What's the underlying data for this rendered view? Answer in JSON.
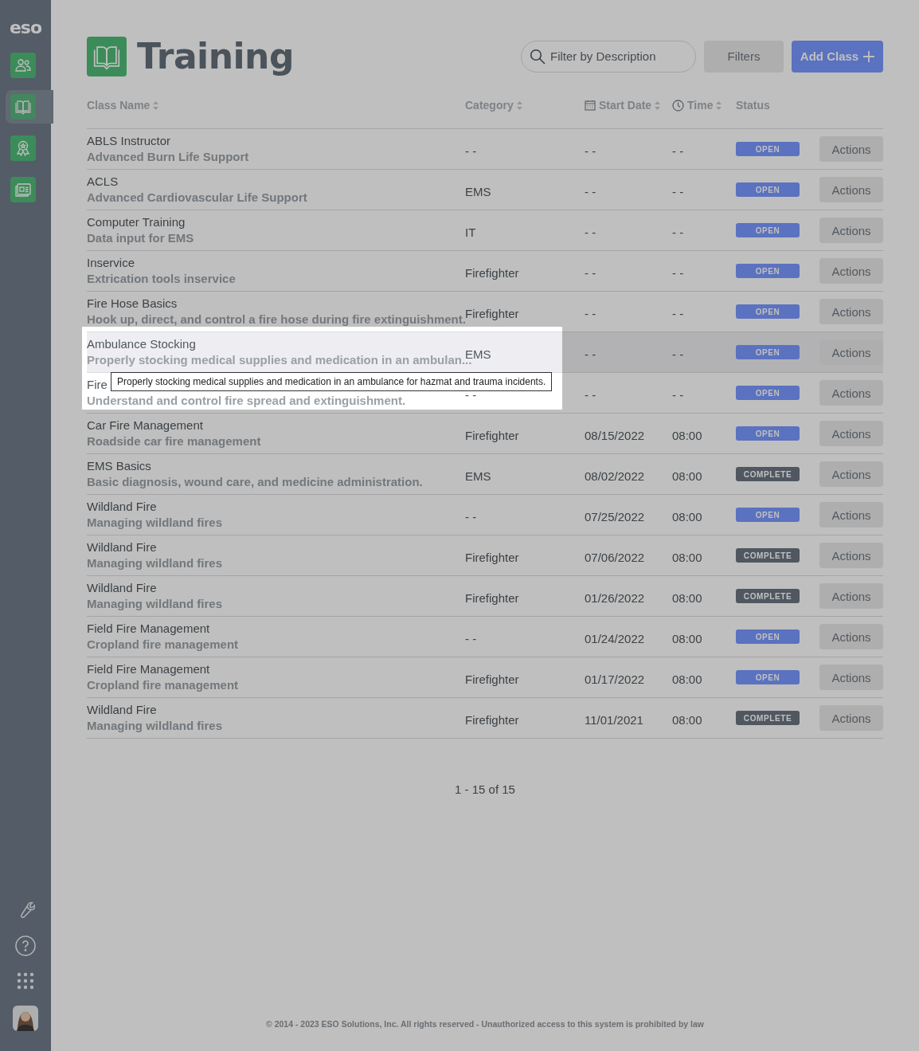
{
  "sidebar": {
    "logo": "eso",
    "nav": [
      {
        "selected": false
      },
      {
        "selected": true
      },
      {
        "selected": false
      },
      {
        "selected": false
      }
    ]
  },
  "header": {
    "title": "Training",
    "search": {
      "placeholder": "Filter by Description"
    },
    "filters_button": "Filters",
    "add_button": "Add Class"
  },
  "table": {
    "columns": [
      {
        "label": "Class Name",
        "sortable": true
      },
      {
        "label": "Category",
        "sortable": true
      },
      {
        "label": "Start Date",
        "sortable": true
      },
      {
        "label": "Time",
        "sortable": true
      },
      {
        "label": "Status",
        "sortable": false
      }
    ],
    "rows": [
      {
        "name": "ABLS Instructor",
        "description": "Advanced Burn Life Support",
        "category": "- -",
        "start_date": "- -",
        "time": "- -",
        "status": {
          "label": "OPEN",
          "kind": "open"
        },
        "action": "Actions",
        "highlighted": false
      },
      {
        "name": "ACLS",
        "description": "Advanced Cardiovascular Life Support",
        "category": "EMS",
        "start_date": "- -",
        "time": "- -",
        "status": {
          "label": "OPEN",
          "kind": "open"
        },
        "action": "Actions",
        "highlighted": false
      },
      {
        "name": "Computer Training",
        "description": "Data input for EMS",
        "category": "IT",
        "start_date": "- -",
        "time": "- -",
        "status": {
          "label": "OPEN",
          "kind": "open"
        },
        "action": "Actions",
        "highlighted": false
      },
      {
        "name": "Inservice",
        "description": "Extrication tools inservice",
        "category": "Firefighter",
        "start_date": "- -",
        "time": "- -",
        "status": {
          "label": "OPEN",
          "kind": "open"
        },
        "action": "Actions",
        "highlighted": false
      },
      {
        "name": "Fire Hose Basics",
        "description": "Hook up, direct, and control a fire hose during fire extinguishment.",
        "category": "Firefighter",
        "start_date": "- -",
        "time": "- -",
        "status": {
          "label": "OPEN",
          "kind": "open"
        },
        "action": "Actions",
        "highlighted": false
      },
      {
        "name": "Ambulance Stocking",
        "description": "Properly stocking medical supplies and medication in an ambulan...",
        "category": "EMS",
        "start_date": "- -",
        "time": "- -",
        "status": {
          "label": "OPEN",
          "kind": "open"
        },
        "action": "Actions",
        "highlighted": true,
        "tooltip": "Properly stocking medical supplies and medication in an ambulance for hazmat and trauma incidents."
      },
      {
        "name": "Fire",
        "description": "Understand and control fire spread and extinguishment.",
        "category": "- -",
        "start_date": "- -",
        "time": "- -",
        "status": {
          "label": "OPEN",
          "kind": "open"
        },
        "action": "Actions",
        "highlighted": false
      },
      {
        "name": "Car Fire Management",
        "description": "Roadside car fire management",
        "category": "Firefighter",
        "start_date": "08/15/2022",
        "time": "08:00",
        "status": {
          "label": "OPEN",
          "kind": "open"
        },
        "action": "Actions",
        "highlighted": false
      },
      {
        "name": "EMS Basics",
        "description": "Basic diagnosis, wound care, and medicine administration.",
        "category": "EMS",
        "start_date": "08/02/2022",
        "time": "08:00",
        "status": {
          "label": "COMPLETE",
          "kind": "complete"
        },
        "action": "Actions",
        "highlighted": false
      },
      {
        "name": "Wildland Fire",
        "description": "Managing wildland fires",
        "category": "- -",
        "start_date": "07/25/2022",
        "time": "08:00",
        "status": {
          "label": "OPEN",
          "kind": "open"
        },
        "action": "Actions",
        "highlighted": false
      },
      {
        "name": "Wildland Fire",
        "description": "Managing wildland fires",
        "category": "Firefighter",
        "start_date": "07/06/2022",
        "time": "08:00",
        "status": {
          "label": "COMPLETE",
          "kind": "complete"
        },
        "action": "Actions",
        "highlighted": false
      },
      {
        "name": "Wildland Fire",
        "description": "Managing wildland fires",
        "category": "Firefighter",
        "start_date": "01/26/2022",
        "time": "08:00",
        "status": {
          "label": "COMPLETE",
          "kind": "complete"
        },
        "action": "Actions",
        "highlighted": false
      },
      {
        "name": "Field Fire Management",
        "description": "Cropland fire management",
        "category": "- -",
        "start_date": "01/24/2022",
        "time": "08:00",
        "status": {
          "label": "OPEN",
          "kind": "open"
        },
        "action": "Actions",
        "highlighted": false
      },
      {
        "name": "Field Fire Management",
        "description": "Cropland fire management",
        "category": "Firefighter",
        "start_date": "01/17/2022",
        "time": "08:00",
        "status": {
          "label": "OPEN",
          "kind": "open"
        },
        "action": "Actions",
        "highlighted": false
      },
      {
        "name": "Wildland Fire",
        "description": "Managing wildland fires",
        "category": "Firefighter",
        "start_date": "11/01/2021",
        "time": "08:00",
        "status": {
          "label": "COMPLETE",
          "kind": "complete"
        },
        "action": "Actions",
        "highlighted": false
      }
    ]
  },
  "pagination": "1 - 15 of 15",
  "footer": "© 2014 - 2023 ESO Solutions, Inc. All rights reserved - Unauthorized access to this system is prohibited by law"
}
